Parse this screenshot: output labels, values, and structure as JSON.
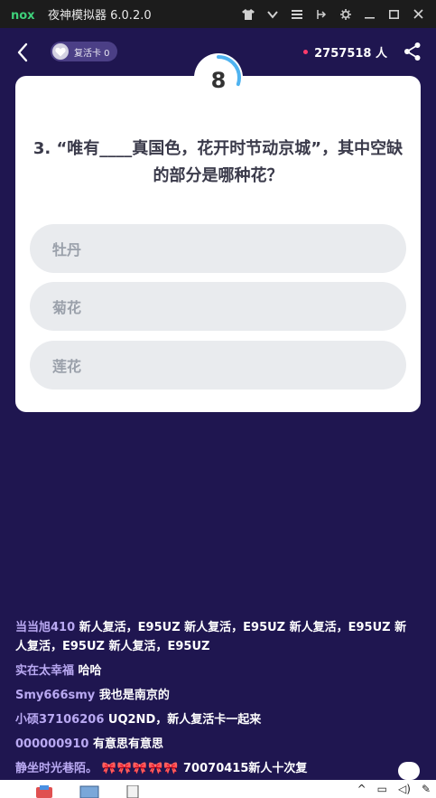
{
  "titlebar": {
    "title": "夜神模拟器 6.0.2.0",
    "icons": [
      "shirt-icon",
      "chevron-down-icon",
      "menu-icon",
      "pin-icon",
      "gear-icon",
      "minimize-icon",
      "maximize-icon",
      "close-icon"
    ]
  },
  "header": {
    "revive_card_label": "复活卡 0",
    "online_count": "2757518 人",
    "accent_dot_color": "#ff3b6b"
  },
  "timer": {
    "value": "8",
    "remaining_fraction": 0.3
  },
  "question": {
    "text": "3. “唯有____真国色，花开时节动京城”，其中空缺的部分是哪种花？",
    "options": [
      "牡丹",
      "菊花",
      "莲花"
    ]
  },
  "comments": [
    {
      "user": "当当旭410",
      "text": "新人复活，E95UZ 新人复活，E95UZ 新人复活，E95UZ 新人复活，E95UZ  新人复活，E95UZ"
    },
    {
      "user": "实在太幸福",
      "text": "哈哈"
    },
    {
      "user": "Smy666smy",
      "text": "我也是南京的"
    },
    {
      "user": "小硕37106206",
      "text": "UQ2ND，新人复活卡一起来"
    },
    {
      "user": "000000910",
      "text": "有意思有意思"
    },
    {
      "user": "静坐时光巷陌。",
      "emojis": "🎀🎀🎀🎀🎀",
      "text": "70070415新人十次复"
    }
  ],
  "colors": {
    "background": "#1f1650",
    "card": "#ffffff",
    "option": "#e9ebee",
    "username": "#b9a9f2",
    "timer_arc": "#4fb3f0"
  }
}
